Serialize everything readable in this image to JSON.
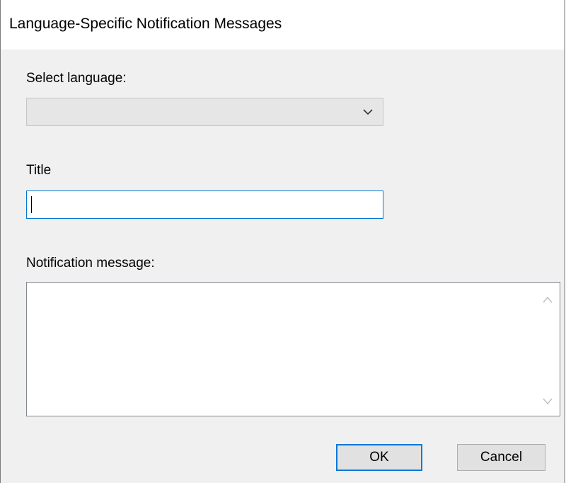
{
  "window": {
    "title": "Language-Specific Notification Messages"
  },
  "form": {
    "language_label": "Select language:",
    "language_value": "",
    "title_label": "Title",
    "title_value": "",
    "message_label": "Notification message:",
    "message_value": ""
  },
  "buttons": {
    "ok_label": "OK",
    "cancel_label": "Cancel"
  },
  "icons": {
    "dropdown": "chevron-down-icon",
    "scroll_up": "chevron-up-icon",
    "scroll_down": "chevron-down-icon"
  },
  "colors": {
    "focus_border": "#0078d7",
    "button_face": "#e1e1e1",
    "dialog_background": "#f0f0f0"
  }
}
